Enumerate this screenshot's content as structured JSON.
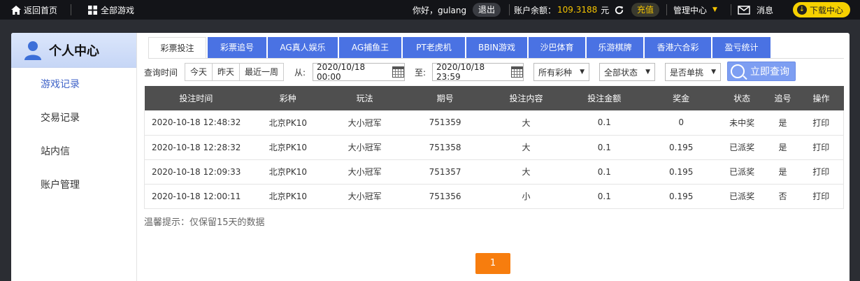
{
  "topbar": {
    "home_label": "返回首页",
    "all_games_label": "全部游戏",
    "greeting": "你好，gulang",
    "logout_label": "退出",
    "balance_label": "账户余额：",
    "balance_value": "109.3188",
    "currency": "元",
    "recharge_label": "充值",
    "manage_label": "管理中心",
    "message_label": "消息",
    "download_label": "下载中心"
  },
  "sidebar": {
    "title": "个人中心",
    "items": [
      {
        "label": "游戏记录",
        "active": true
      },
      {
        "label": "交易记录",
        "active": false
      },
      {
        "label": "站内信",
        "active": false
      },
      {
        "label": "账户管理",
        "active": false
      }
    ]
  },
  "tabs": [
    {
      "label": "彩票投注",
      "active": true
    },
    {
      "label": "彩票追号",
      "active": false
    },
    {
      "label": "AG真人娱乐",
      "active": false
    },
    {
      "label": "AG捕鱼王",
      "active": false
    },
    {
      "label": "PT老虎机",
      "active": false
    },
    {
      "label": "BBIN游戏",
      "active": false
    },
    {
      "label": "沙巴体育",
      "active": false
    },
    {
      "label": "乐游棋牌",
      "active": false
    },
    {
      "label": "香港六合彩",
      "active": false
    },
    {
      "label": "盈亏统计",
      "active": false
    }
  ],
  "filters": {
    "query_time_label": "查询时间",
    "quick": [
      "今天",
      "昨天",
      "最近一周"
    ],
    "from_label": "从:",
    "from_value": "2020/10/18 00:00",
    "to_label": "至:",
    "to_value": "2020/10/18 23:59",
    "lottery_select": "所有彩种",
    "status_select": "全部状态",
    "single_select": "是否单挑",
    "query_button": "立即查询"
  },
  "table": {
    "headers": [
      "投注时间",
      "彩种",
      "玩法",
      "期号",
      "投注内容",
      "投注金额",
      "奖金",
      "状态",
      "追号",
      "操作"
    ],
    "rows": [
      {
        "time": "2020-10-18 12:48:32",
        "lottery": "北京PK10",
        "play": "大小冠军",
        "issue": "751359",
        "content": "大",
        "amount": "0.1",
        "prize": "0",
        "status": "未中奖",
        "chase": "是",
        "action": "打印",
        "win": false
      },
      {
        "time": "2020-10-18 12:28:32",
        "lottery": "北京PK10",
        "play": "大小冠军",
        "issue": "751358",
        "content": "大",
        "amount": "0.1",
        "prize": "0.195",
        "status": "已派奖",
        "chase": "是",
        "action": "打印",
        "win": true
      },
      {
        "time": "2020-10-18 12:09:33",
        "lottery": "北京PK10",
        "play": "大小冠军",
        "issue": "751357",
        "content": "大",
        "amount": "0.1",
        "prize": "0.195",
        "status": "已派奖",
        "chase": "是",
        "action": "打印",
        "win": true
      },
      {
        "time": "2020-10-18 12:00:11",
        "lottery": "北京PK10",
        "play": "大小冠军",
        "issue": "751356",
        "content": "小",
        "amount": "0.1",
        "prize": "0.195",
        "status": "已派奖",
        "chase": "否",
        "action": "打印",
        "win": true
      }
    ]
  },
  "tip": "温馨提示：仅保留15天的数据",
  "pagination": {
    "current": "1"
  },
  "colors": {
    "accent": "#4a72e3",
    "win": "#e23b3b",
    "pager": "#f77d0e",
    "gold": "#f5c400"
  }
}
